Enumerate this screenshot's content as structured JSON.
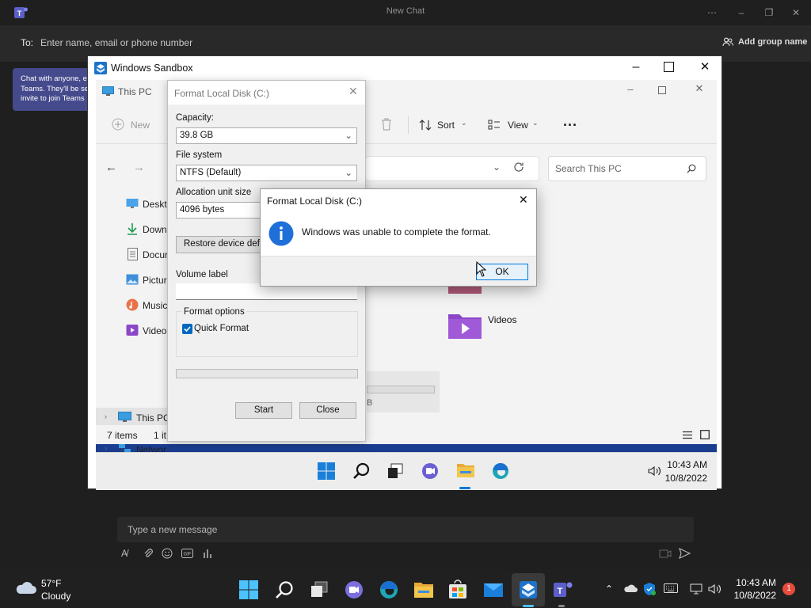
{
  "teams": {
    "window_title": "New Chat",
    "to_label": "To:",
    "to_placeholder": "Enter name, email or phone number",
    "add_group_name": "Add group name",
    "callout_lines": [
      "Chat with anyone, e",
      "Teams. They'll be se",
      "invite to join Teams"
    ],
    "composer_placeholder": "Type a new message"
  },
  "sandbox": {
    "window_title": "Windows Sandbox",
    "explorer": {
      "title": "This PC",
      "new_label": "New",
      "sort_label": "Sort",
      "view_label": "View",
      "more_label": "...",
      "search_placeholder": "Search This PC",
      "nav_items": [
        "Deskto",
        "Down",
        "Docur",
        "Pictur",
        "Music",
        "Video",
        "This PC",
        "Networ"
      ],
      "videos_label": "Videos",
      "drive_size_fragment": "B",
      "status_items": "7 items",
      "status_selected": "1 it"
    },
    "taskbar": {
      "time": "10:43 AM",
      "date": "10/8/2022"
    }
  },
  "format_dialog": {
    "title": "Format Local Disk (C:)",
    "capacity_label": "Capacity:",
    "capacity_value": "39.8 GB",
    "filesystem_label": "File system",
    "filesystem_value": "NTFS (Default)",
    "alloc_label": "Allocation unit size",
    "alloc_value": "4096 bytes",
    "restore_label": "Restore device defa",
    "volume_label": "Volume label",
    "volume_value": "",
    "options_label": "Format options",
    "quick_format_label": "Quick Format",
    "quick_format_checked": true,
    "start_label": "Start",
    "close_label": "Close"
  },
  "message_box": {
    "title": "Format Local Disk (C:)",
    "message": "Windows was unable to complete the format.",
    "ok_label": "OK"
  },
  "host_taskbar": {
    "weather_temp": "57°F",
    "weather_desc": "Cloudy",
    "time": "10:43 AM",
    "date": "10/8/2022",
    "notification_count": "1"
  },
  "colors": {
    "accent": "#0078d7",
    "teams_purple": "#454a8c",
    "folder_yellow": "#f3c54a"
  }
}
